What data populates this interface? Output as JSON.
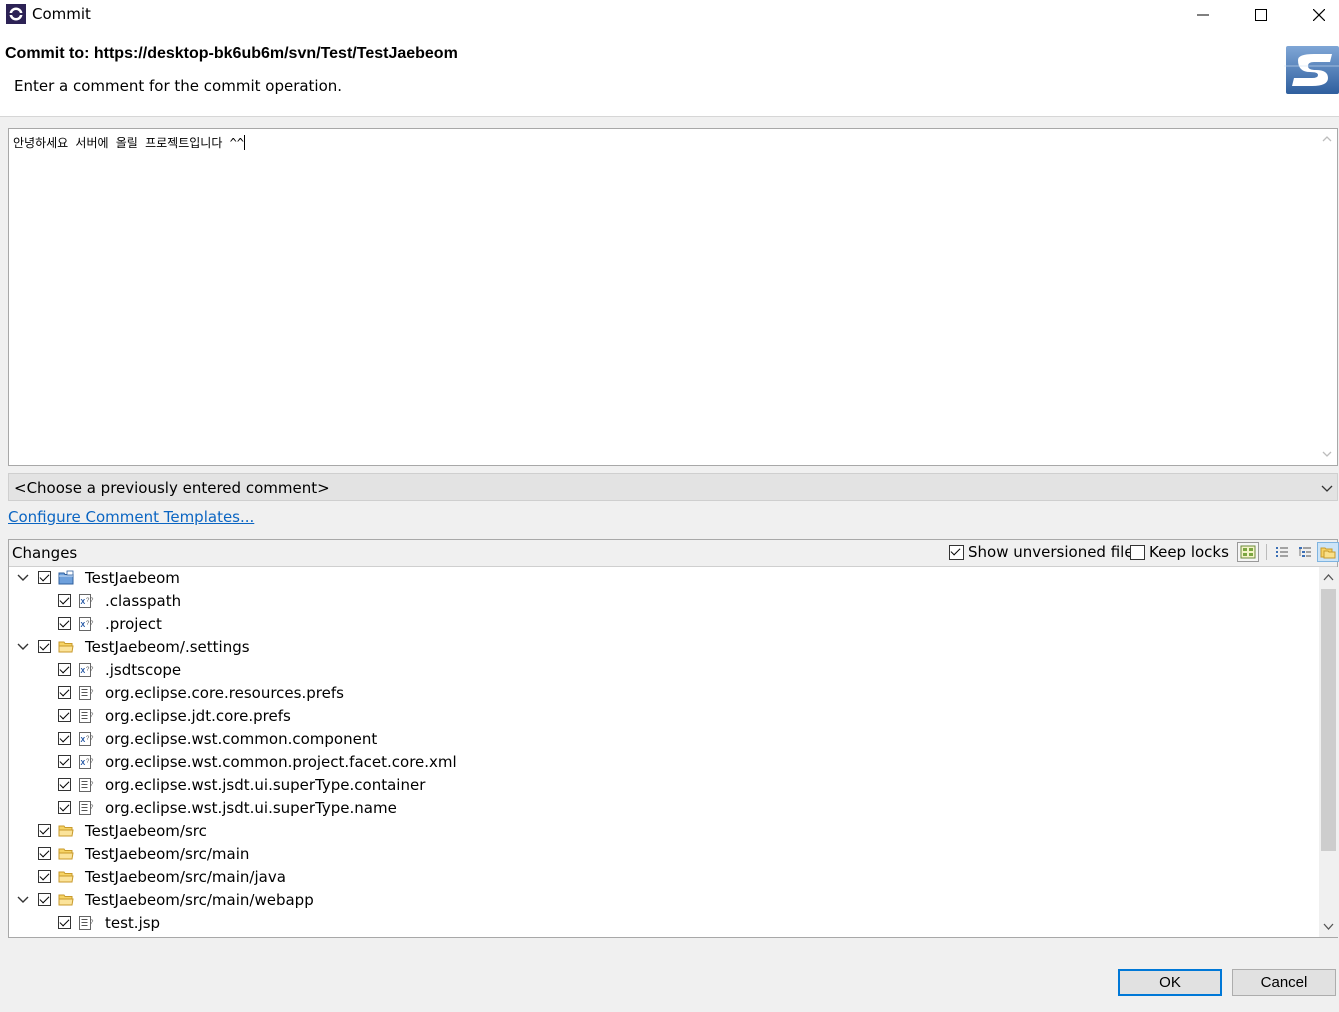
{
  "window": {
    "title": "Commit",
    "minimize_icon": "minimize-icon",
    "maximize_icon": "maximize-icon",
    "close_icon": "close-icon"
  },
  "header": {
    "title": "Commit to: https://desktop-bk6ub6m/svn/Test/TestJaebeom",
    "description": "Enter a comment for the commit operation.",
    "logo_icon": "svn-logo-icon"
  },
  "comment": {
    "text": "안녕하세요 서버에 올릴 프로젝트입니다 ^^"
  },
  "previous_comment": {
    "value": "<Choose a previously entered comment>"
  },
  "templates_link": "Configure Comment Templates...",
  "changes": {
    "label": "Changes",
    "show_unversioned": {
      "label": "Show unversioned files",
      "checked": true
    },
    "keep_locks": {
      "label": "Keep locks",
      "checked": false
    },
    "toolbar": [
      "layout-icon",
      "flat-list-icon",
      "tree-view-icon",
      "compressed-folders-icon"
    ],
    "items": [
      {
        "label": "TestJaebeom",
        "level": 0,
        "expandable": true,
        "type": "project",
        "checked": true
      },
      {
        "label": ".classpath",
        "level": 1,
        "expandable": false,
        "type": "xml-file",
        "checked": true
      },
      {
        "label": ".project",
        "level": 1,
        "expandable": false,
        "type": "xml-file",
        "checked": true
      },
      {
        "label": "TestJaebeom/.settings",
        "level": 0,
        "expandable": true,
        "type": "folder",
        "checked": true
      },
      {
        "label": ".jsdtscope",
        "level": 1,
        "expandable": false,
        "type": "xml-file",
        "checked": true
      },
      {
        "label": "org.eclipse.core.resources.prefs",
        "level": 1,
        "expandable": false,
        "type": "text-file",
        "checked": true
      },
      {
        "label": "org.eclipse.jdt.core.prefs",
        "level": 1,
        "expandable": false,
        "type": "text-file",
        "checked": true
      },
      {
        "label": "org.eclipse.wst.common.component",
        "level": 1,
        "expandable": false,
        "type": "xml-file",
        "checked": true
      },
      {
        "label": "org.eclipse.wst.common.project.facet.core.xml",
        "level": 1,
        "expandable": false,
        "type": "xml-file",
        "checked": true
      },
      {
        "label": "org.eclipse.wst.jsdt.ui.superType.container",
        "level": 1,
        "expandable": false,
        "type": "text-file",
        "checked": true
      },
      {
        "label": "org.eclipse.wst.jsdt.ui.superType.name",
        "level": 1,
        "expandable": false,
        "type": "text-file",
        "checked": true
      },
      {
        "label": "TestJaebeom/src",
        "level": 0,
        "expandable": false,
        "type": "folder",
        "checked": true
      },
      {
        "label": "TestJaebeom/src/main",
        "level": 0,
        "expandable": false,
        "type": "folder",
        "checked": true
      },
      {
        "label": "TestJaebeom/src/main/java",
        "level": 0,
        "expandable": false,
        "type": "folder",
        "checked": true
      },
      {
        "label": "TestJaebeom/src/main/webapp",
        "level": 0,
        "expandable": true,
        "type": "folder",
        "checked": true
      },
      {
        "label": "test.jsp",
        "level": 1,
        "expandable": false,
        "type": "text-file",
        "checked": true
      }
    ]
  },
  "buttons": {
    "ok": "OK",
    "cancel": "Cancel"
  }
}
